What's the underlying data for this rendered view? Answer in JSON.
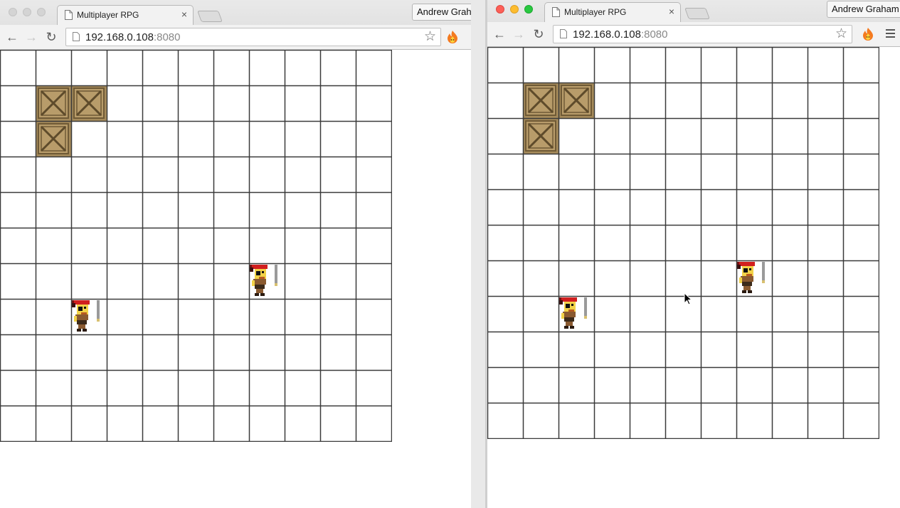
{
  "windows": [
    {
      "tab": {
        "title": "Multiplayer RPG",
        "close": "×"
      },
      "profile": "Andrew Graham",
      "address": {
        "host": "192.168.0.108",
        "port": ":8080"
      },
      "buttons": {
        "back": "←",
        "forward": "→",
        "reload": "↻",
        "star": "☆"
      },
      "icons": [
        "page-icon",
        "star-icon",
        "fire-extension-icon",
        "menu-icon"
      ]
    },
    {
      "tab": {
        "title": "Multiplayer RPG",
        "close": "×"
      },
      "profile": "Andrew Graham",
      "address": {
        "host": "192.168.0.108",
        "port": ":8080"
      },
      "buttons": {
        "back": "←",
        "forward": "→",
        "reload": "↻",
        "star": "☆"
      },
      "icons": [
        "page-icon",
        "star-icon",
        "fire-extension-icon",
        "menu-icon"
      ]
    }
  ],
  "game": {
    "board": {
      "columns": 11,
      "rows": 11
    },
    "crates": [
      {
        "col": 1,
        "row": 1
      },
      {
        "col": 2,
        "row": 1
      },
      {
        "col": 1,
        "row": 2
      }
    ],
    "players": [
      {
        "col": 2,
        "row": 7
      },
      {
        "col": 7,
        "row": 6
      }
    ]
  },
  "colors": {
    "grid_line": "#3a3a3a",
    "crate": "#a58a5a",
    "pirate_bandana": "#d11f1f",
    "pirate_skin": "#f2d248"
  }
}
